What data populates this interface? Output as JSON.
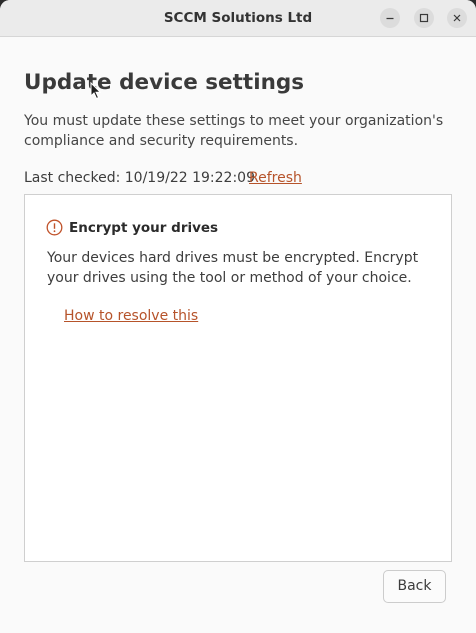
{
  "window": {
    "title": "SCCM Solutions Ltd",
    "controls": [
      "minimize-icon",
      "maximize-icon",
      "close-icon"
    ]
  },
  "page": {
    "heading": "Update device settings",
    "description": "You must update these settings to meet your organization's compliance and security requirements.",
    "last_checked": "Last checked: 10/19/22 19:22:09",
    "refresh_label": "Refresh"
  },
  "issue": {
    "icon": "alert-circle-icon",
    "title": "Encrypt your drives",
    "body": "Your devices hard drives must be encrypted. Encrypt your drives using the tool or method of your choice.",
    "link_label": "How to resolve this"
  },
  "footer": {
    "back_label": "Back"
  },
  "colors": {
    "accent_link": "#b6532a",
    "alert_icon": "#c0522a"
  }
}
